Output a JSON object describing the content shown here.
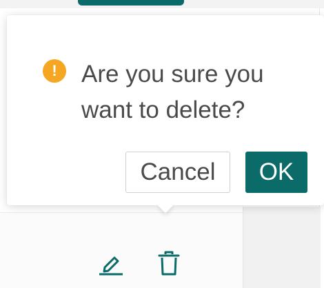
{
  "dialog": {
    "icon": "warning-icon",
    "message": "Are you sure you want to delete?",
    "cancel_label": "Cancel",
    "ok_label": "OK"
  },
  "row_actions": {
    "edit_icon": "pencil-icon",
    "delete_icon": "trash-icon"
  },
  "colors": {
    "primary": "#0a6b68",
    "warning": "#f5a623",
    "text": "#4a4a4a"
  }
}
